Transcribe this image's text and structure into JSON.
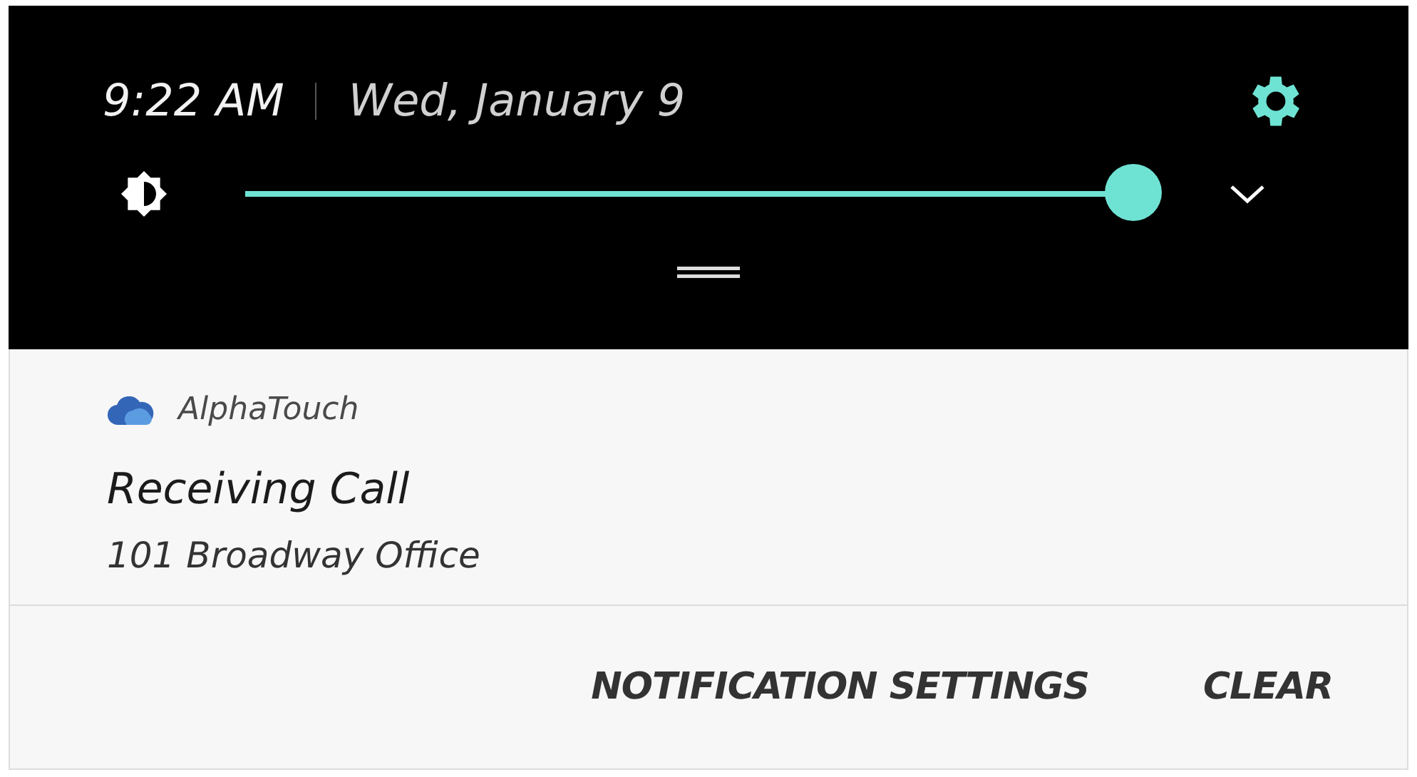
{
  "header": {
    "time": "9:22 AM",
    "date": "Wed, January 9"
  },
  "brightness": {
    "level": 1.0
  },
  "notification": {
    "app_name": "AlphaTouch",
    "title": "Receiving Call",
    "text": "101 Broadway Office"
  },
  "actions": [
    "NOTIFICATION SETTINGS",
    "CLEAR"
  ]
}
